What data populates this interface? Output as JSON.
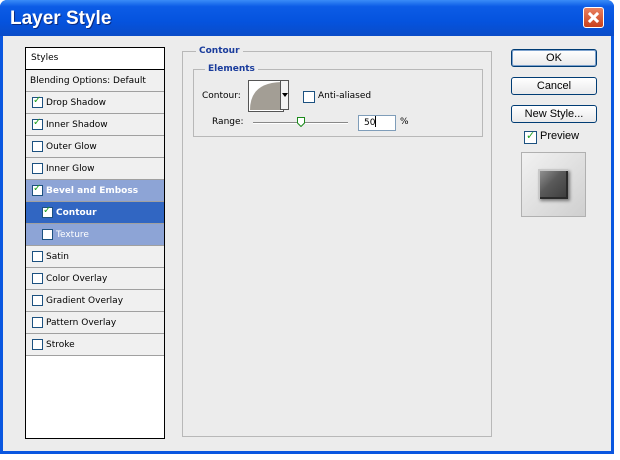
{
  "window": {
    "title": "Layer Style"
  },
  "styles_panel": {
    "header": "Styles",
    "blending": "Blending Options: Default",
    "items": [
      {
        "label": "Drop Shadow",
        "checked": true
      },
      {
        "label": "Inner Shadow",
        "checked": true
      },
      {
        "label": "Outer Glow",
        "checked": false
      },
      {
        "label": "Inner Glow",
        "checked": false
      },
      {
        "label": "Bevel and Emboss",
        "checked": true
      },
      {
        "label": "Contour",
        "checked": true
      },
      {
        "label": "Texture",
        "checked": false
      },
      {
        "label": "Satin",
        "checked": false
      },
      {
        "label": "Color Overlay",
        "checked": false
      },
      {
        "label": "Gradient Overlay",
        "checked": false
      },
      {
        "label": "Pattern Overlay",
        "checked": false
      },
      {
        "label": "Stroke",
        "checked": false
      }
    ]
  },
  "contour_section": {
    "title": "Contour",
    "elements_title": "Elements",
    "contour_label": "Contour:",
    "anti_aliased_label": "Anti-aliased",
    "anti_aliased_checked": false,
    "range_label": "Range:",
    "range_value": "50",
    "range_unit": "%"
  },
  "buttons": {
    "ok": "OK",
    "cancel": "Cancel",
    "new_style": "New Style..."
  },
  "preview": {
    "label": "Preview",
    "checked": true
  },
  "icons": {
    "close": "close-icon",
    "dropdown": "chevron-down-icon",
    "slider": "slider-thumb-icon"
  }
}
